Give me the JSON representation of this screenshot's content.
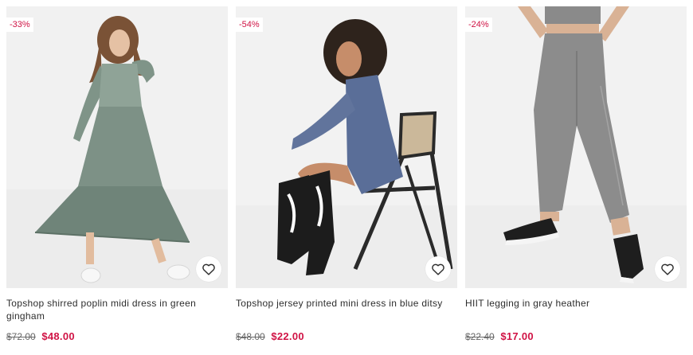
{
  "colors": {
    "sale": "#d01345",
    "text": "#2d2d2d",
    "was": "#666666",
    "background": "#ffffff"
  },
  "products": [
    {
      "badge": "-33%",
      "title": "Topshop shirred poplin midi dress in green gingham",
      "was_price": "$72.00",
      "sale_price": "$48.00",
      "favourite_icon": "heart-icon"
    },
    {
      "badge": "-54%",
      "title": "Topshop jersey printed mini dress in blue ditsy",
      "was_price": "$48.00",
      "sale_price": "$22.00",
      "favourite_icon": "heart-icon"
    },
    {
      "badge": "-24%",
      "title": "HIIT legging in gray heather",
      "was_price": "$22.40",
      "sale_price": "$17.00",
      "favourite_icon": "heart-icon"
    }
  ]
}
